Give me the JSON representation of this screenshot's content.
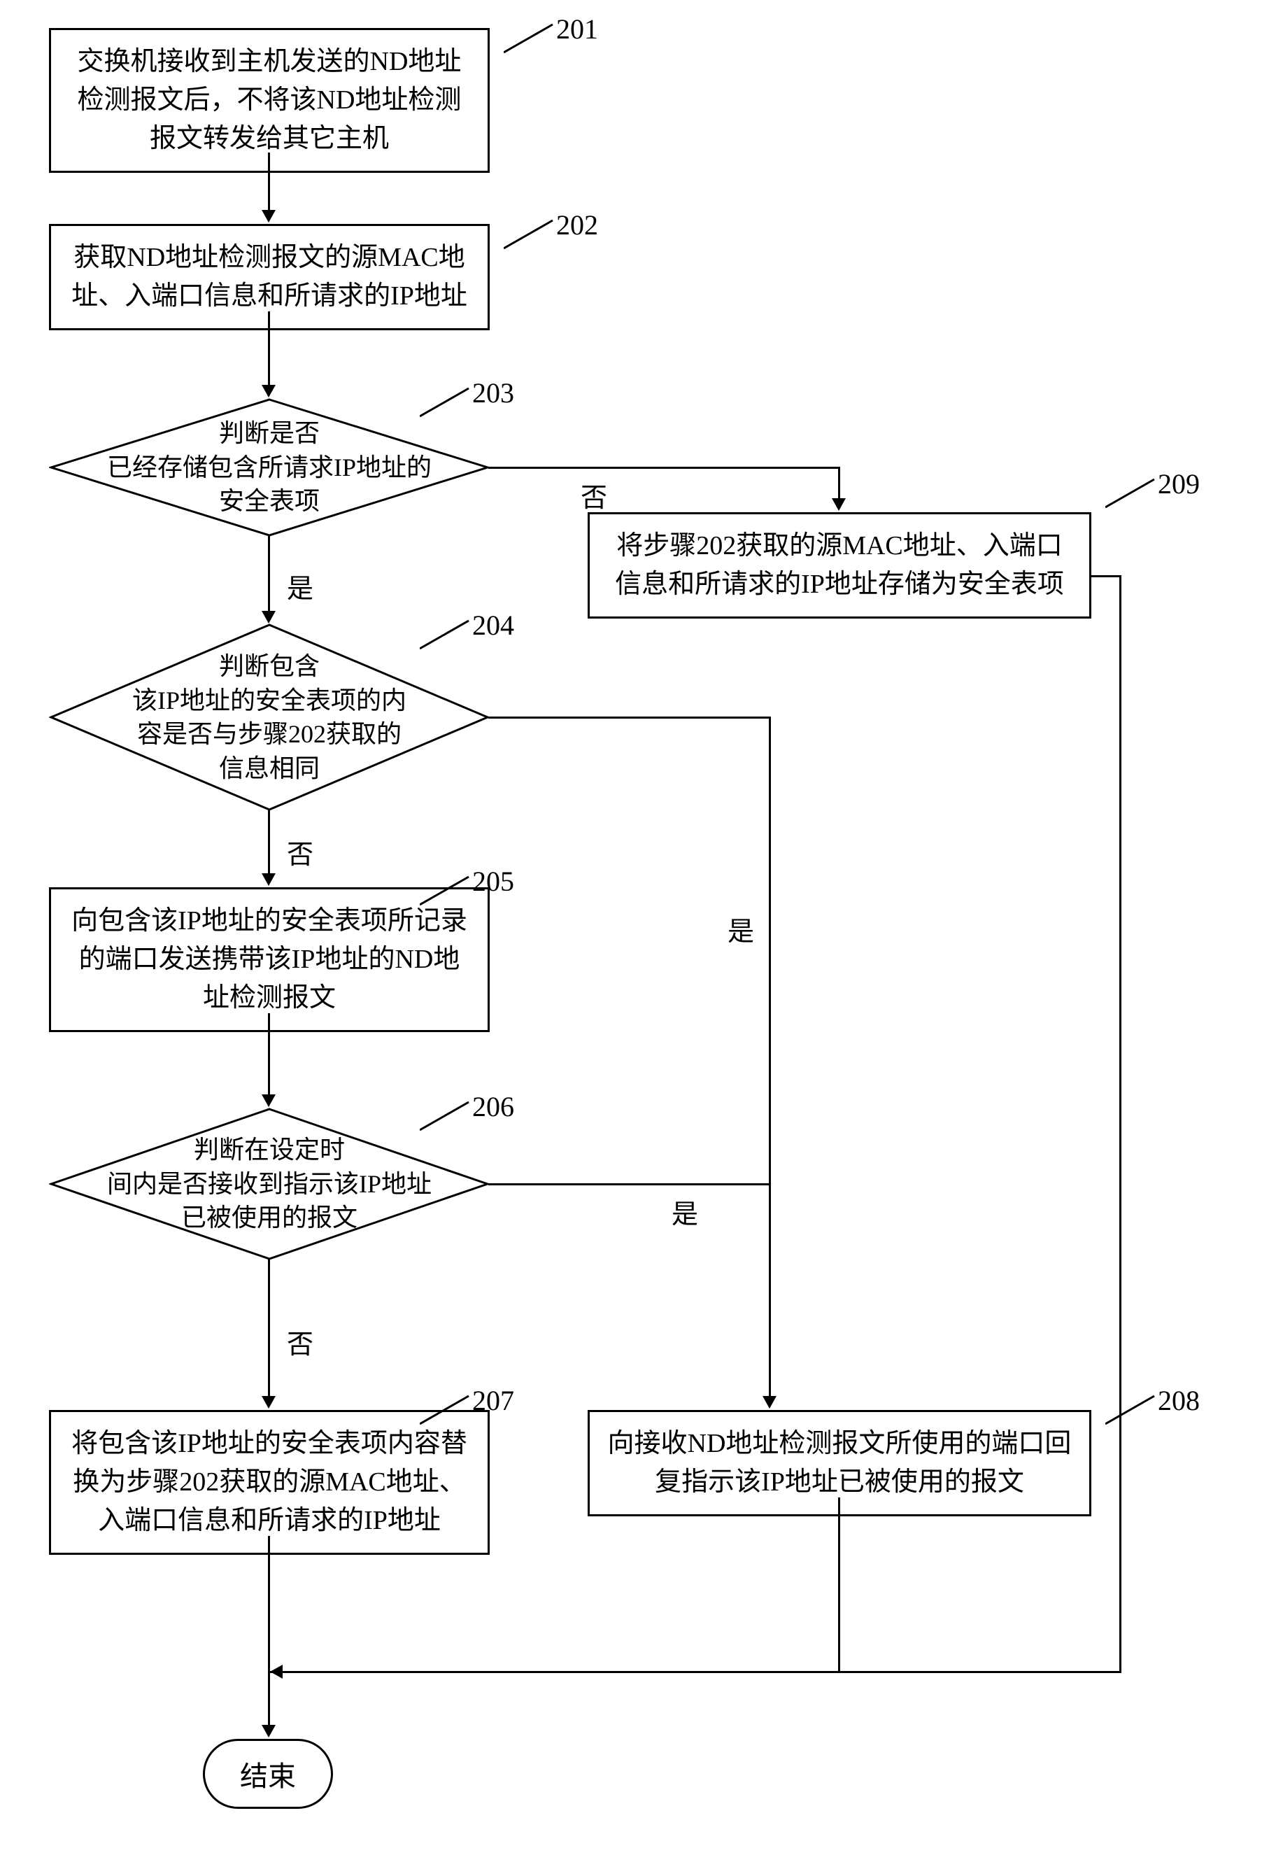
{
  "flowchart": {
    "steps": {
      "201": {
        "num": "201",
        "text": "交换机接收到主机发送的ND地址检测报文后，不将该ND地址检测报文转发给其它主机"
      },
      "202": {
        "num": "202",
        "text": "获取ND地址检测报文的源MAC地址、入端口信息和所请求的IP地址"
      },
      "203": {
        "num": "203",
        "text": "判断是否\n已经存储包含所请求IP地址的\n安全表项"
      },
      "204": {
        "num": "204",
        "text": "判断包含\n该IP地址的安全表项的内\n容是否与步骤202获取的\n信息相同"
      },
      "205": {
        "num": "205",
        "text": "向包含该IP地址的安全表项所记录的端口发送携带该IP地址的ND地址检测报文"
      },
      "206": {
        "num": "206",
        "text": "判断在设定时\n间内是否接收到指示该IP地址\n已被使用的报文"
      },
      "207": {
        "num": "207",
        "text": "将包含该IP地址的安全表项内容替换为步骤202获取的源MAC地址、入端口信息和所请求的IP地址"
      },
      "208": {
        "num": "208",
        "text": "向接收ND地址检测报文所使用的端口回复指示该IP地址已被使用的报文"
      },
      "209": {
        "num": "209",
        "text": "将步骤202获取的源MAC地址、入端口信息和所请求的IP地址存储为安全表项"
      }
    },
    "branches": {
      "yes": "是",
      "no": "否"
    },
    "terminator": "结束"
  }
}
